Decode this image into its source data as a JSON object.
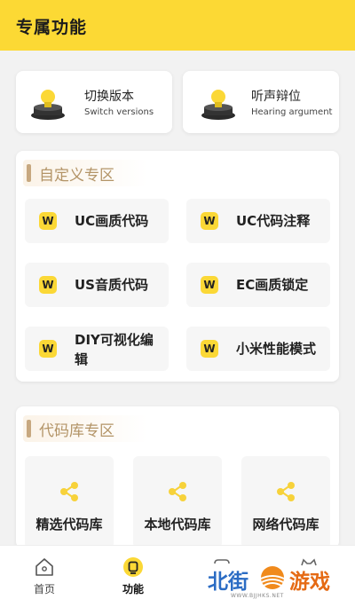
{
  "header": {
    "title": "专属功能",
    "bg_color": "#fcd934"
  },
  "features": [
    {
      "name": "切换版本",
      "sub": "Switch versions",
      "icon": "lamp-icon"
    },
    {
      "name": "听声辩位",
      "sub": "Hearing argument",
      "icon": "lamp-icon"
    }
  ],
  "custom_section": {
    "title": "自定义专区",
    "items": [
      {
        "label": "UC画质代码",
        "icon": "w-badge-icon"
      },
      {
        "label": "UC代码注释",
        "icon": "w-badge-icon"
      },
      {
        "label": "US音质代码",
        "icon": "w-badge-icon"
      },
      {
        "label": "EC画质锁定",
        "icon": "w-badge-icon"
      },
      {
        "label": "DIY可视化编辑",
        "icon": "w-badge-icon"
      },
      {
        "label": "小米性能模式",
        "icon": "w-badge-icon"
      }
    ]
  },
  "library_section": {
    "title": "代码库专区",
    "items": [
      {
        "label": "精选代码库",
        "icon": "share-icon"
      },
      {
        "label": "本地代码库",
        "icon": "share-icon"
      },
      {
        "label": "网络代码库",
        "icon": "share-icon"
      }
    ]
  },
  "tabbar": {
    "tabs": [
      {
        "label": "首页",
        "icon": "home-icon",
        "active": false
      },
      {
        "label": "功能",
        "icon": "function-icon",
        "active": true
      },
      {
        "label": "",
        "icon": "tab-icon",
        "active": false
      },
      {
        "label": "",
        "icon": "tab-icon",
        "active": false
      }
    ]
  },
  "watermark": {
    "part1": "北街",
    "part2": "游戏",
    "sub": "WWW.BJJHKS.NET"
  },
  "colors": {
    "accent": "#fcd934",
    "section_title": "#b39467",
    "tile_bg": "#f6f6f6"
  }
}
